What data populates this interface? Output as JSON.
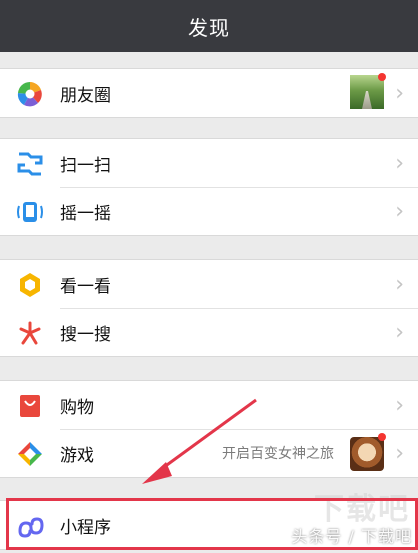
{
  "navbar": {
    "title": "发现"
  },
  "groups": [
    {
      "items": [
        {
          "label": "朋友圈",
          "icon": "moments-icon"
        }
      ]
    },
    {
      "items": [
        {
          "label": "扫一扫",
          "icon": "scan-icon"
        },
        {
          "label": "摇一摇",
          "icon": "shake-icon"
        }
      ]
    },
    {
      "items": [
        {
          "label": "看一看",
          "icon": "top-stories-icon"
        },
        {
          "label": "搜一搜",
          "icon": "search-icon"
        }
      ]
    },
    {
      "items": [
        {
          "label": "购物",
          "icon": "shopping-icon"
        },
        {
          "label": "游戏",
          "icon": "games-icon",
          "subtext": "开启百变女神之旅"
        }
      ]
    },
    {
      "items": [
        {
          "label": "小程序",
          "icon": "mini-programs-icon"
        }
      ]
    }
  ],
  "watermark": {
    "text": "头条号 / 下载吧",
    "logo": "下载吧"
  },
  "colors": {
    "navbar": "#393a3f",
    "background": "#ebebeb",
    "badge": "#f43530",
    "highlight": "#e3364a"
  }
}
